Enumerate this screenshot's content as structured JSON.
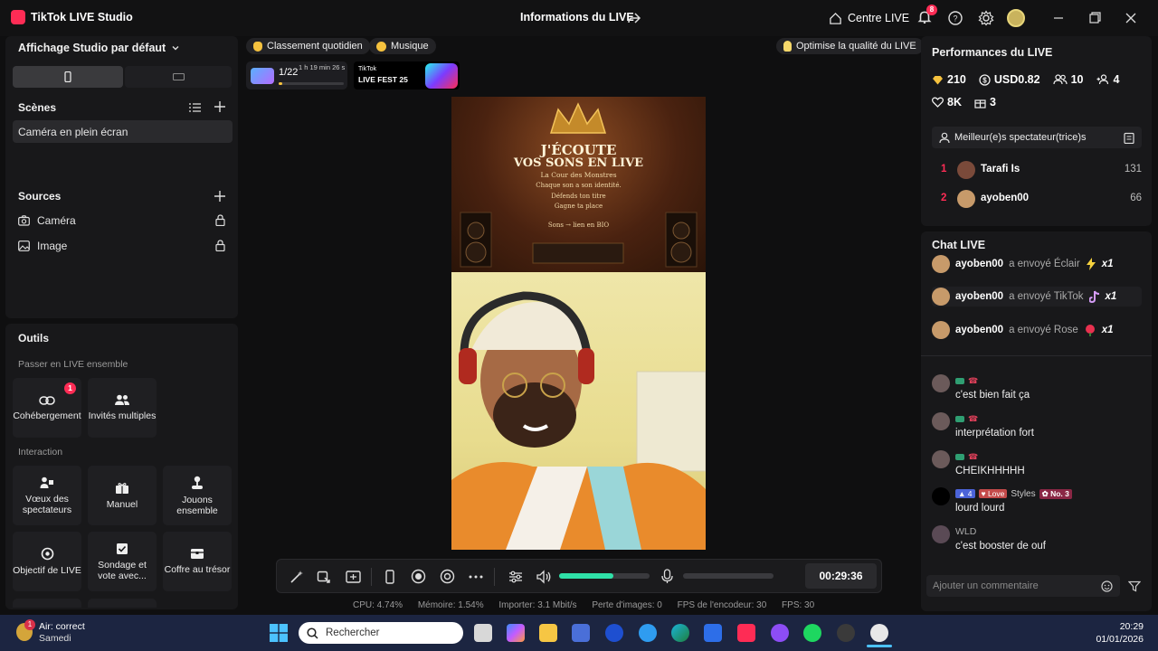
{
  "titlebar": {
    "app_title": "TikTok LIVE Studio",
    "live_info": "Informations du LIVE",
    "centre_live": "Centre LIVE",
    "notification_count": "8"
  },
  "left": {
    "studio_mode": "Affichage Studio par défaut",
    "scenes_title": "Scènes",
    "scene_item": "Caméra en plein écran",
    "sources_title": "Sources",
    "sources": [
      {
        "label": "Caméra"
      },
      {
        "label": "Image"
      }
    ],
    "tools_title": "Outils",
    "together_title": "Passer en LIVE ensemble",
    "cohost_label": "Cohébergement",
    "cohost_badge": "1",
    "multi_guest_label": "Invités multiples",
    "interaction_title": "Interaction",
    "tools_row1": [
      "Vœux des spectateurs",
      "Manuel",
      "Jouons ensemble"
    ],
    "tools_row2": [
      "Objectif de LIVE",
      "Sondage et vote avec...",
      "Coffre au trésor"
    ]
  },
  "center": {
    "chip_daily": "Classement quotidien",
    "chip_music": "Musique",
    "chip_quality": "Optimise la qualité du LIVE",
    "rank_text": "1/22",
    "rank_timer": "1 h 19 min 26 s",
    "fest_brand": "TikTok",
    "fest_name": "LIVE FEST 25",
    "poster": {
      "line1": "J'ÉCOUTE",
      "line2": "VOS SONS EN LIVE",
      "subtitle": "La Cour des Monstres",
      "bullets": [
        "Chaque son a son identité.",
        "Défends ton titre",
        "Gagne ta place"
      ],
      "footer": "Sons → lien en BIO"
    },
    "timer": "00:29:36",
    "volume_level": 0.6,
    "mic_level": 0.0,
    "stats": [
      "CPU: 4.74%",
      "Mémoire: 1.54%",
      "Importer: 3.1 Mbit/s",
      "Perte d'images: 0",
      "FPS de l'encodeur: 30",
      "FPS: 30"
    ]
  },
  "perf": {
    "title": "Performances du LIVE",
    "diamonds": "210",
    "money": "USD0.82",
    "viewers": "10",
    "new_followers": "4",
    "likes": "8K",
    "gifts": "3",
    "top_viewers_title": "Meilleur(e)s spectateur(trice)s",
    "top_viewers": [
      {
        "rank": "1",
        "name": "Tarafi Is",
        "score": "131"
      },
      {
        "rank": "2",
        "name": "ayoben00",
        "score": "66"
      }
    ]
  },
  "chat": {
    "title": "Chat LIVE",
    "gift_events": [
      {
        "user": "ayoben00",
        "action": "a envoyé Éclair",
        "count": "x1"
      },
      {
        "user": "ayoben00",
        "action": "a envoyé TikTok",
        "count": "x1"
      },
      {
        "user": "ayoben00",
        "action": "a envoyé Rose",
        "count": "x1"
      }
    ],
    "messages": [
      {
        "text": "c'est bien fait ça"
      },
      {
        "text": "interprétation fort"
      },
      {
        "text": "CHEIKHHHHH"
      },
      {
        "level": "4",
        "badge": "Love",
        "team": "Styles",
        "rank": "No. 3",
        "text": "lourd lourd"
      },
      {
        "user": "WLD",
        "text": "c'est booster de ouf"
      }
    ],
    "comment_placeholder": "Ajouter un commentaire"
  },
  "taskbar": {
    "weather_label": "Air: correct",
    "weather_sub": "Samedi",
    "weather_badge": "1",
    "search_placeholder": "Rechercher",
    "time": "20:29",
    "date": "01/01/2026"
  }
}
